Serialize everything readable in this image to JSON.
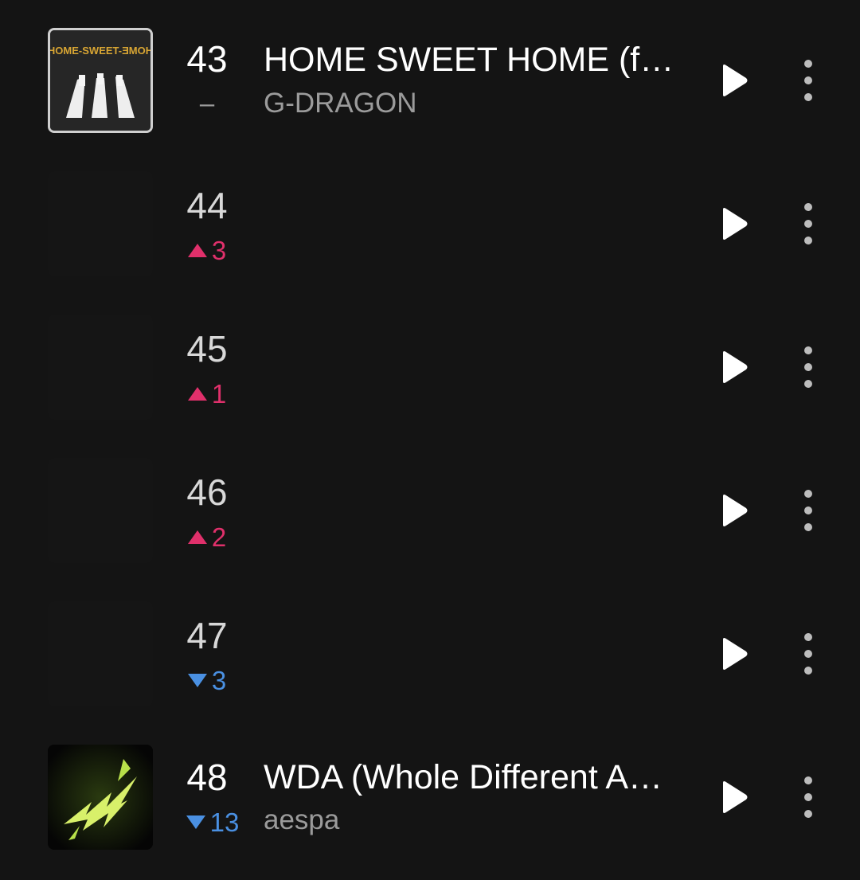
{
  "chart": {
    "rows": [
      {
        "rank": "43",
        "change_direction": "same",
        "change_value": "–",
        "title": "HOME SWEET HOME (f…",
        "artist": "G-DRAGON",
        "album_art": "home-sweet-home-cover",
        "album_art_text": "HOME-SWEET-ƎMOH"
      },
      {
        "rank": "44",
        "change_direction": "up",
        "change_value": "3",
        "title": "",
        "artist": "",
        "album_art": "blank"
      },
      {
        "rank": "45",
        "change_direction": "up",
        "change_value": "1",
        "title": "",
        "artist": "",
        "album_art": "blank"
      },
      {
        "rank": "46",
        "change_direction": "up",
        "change_value": "2",
        "title": "",
        "artist": "",
        "album_art": "blank"
      },
      {
        "rank": "47",
        "change_direction": "down",
        "change_value": "3",
        "title": "",
        "artist": "",
        "album_art": "blank"
      },
      {
        "rank": "48",
        "change_direction": "down",
        "change_value": "13",
        "title": "WDA (Whole Different A…",
        "artist": "aespa",
        "album_art": "wda-cover"
      }
    ]
  },
  "icons": {
    "play": "play-icon",
    "more": "more-vertical-icon",
    "up": "triangle-up-icon",
    "down": "triangle-down-icon"
  },
  "colors": {
    "background": "#141414",
    "up": "#e0306b",
    "down": "#4a90e2",
    "artist_text": "#9b9b9b"
  }
}
